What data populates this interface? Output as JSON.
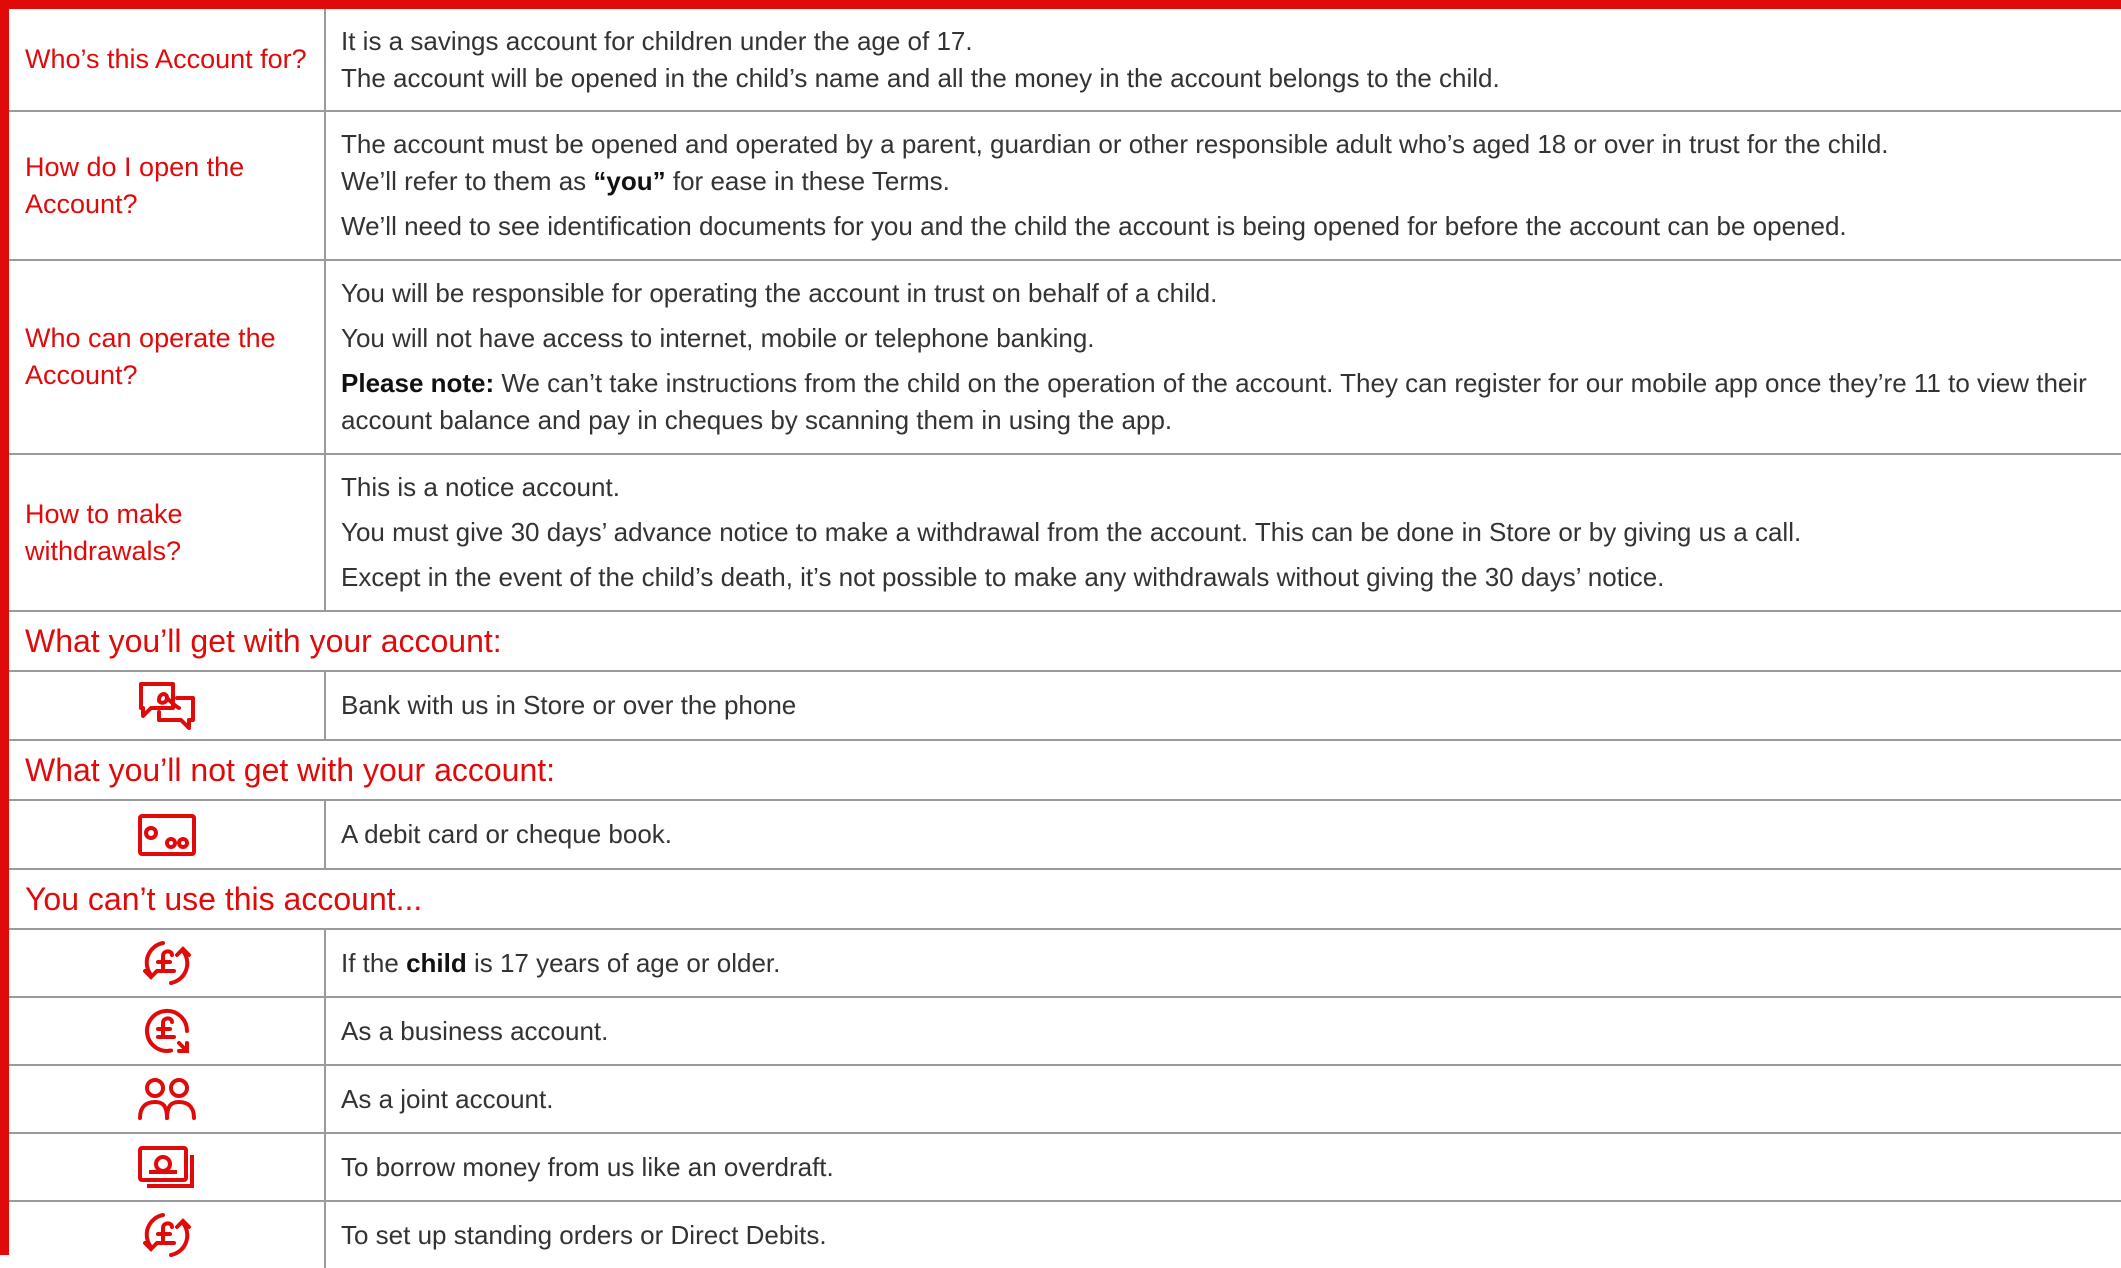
{
  "accent_color": "#e10a0a",
  "questions": [
    {
      "question": "Who’s this Account for?",
      "answers": [
        "It is a savings account for children under the age of 17.",
        "The account will be opened in the child’s name and all the money in the account belongs to the child."
      ]
    },
    {
      "question": "How do I open the Account?",
      "answer_1_a": "The account must be opened and operated by a parent, guardian or other responsible adult who’s aged 18 or over in trust for the child.",
      "answer_1_b": "We’ll refer to them as",
      "answer_1_strong": "“you”",
      "answer_1_c": "for ease in these Terms.",
      "answer_2": "We’ll need to see identification documents for you and the child the account is being opened for before the account can be opened."
    },
    {
      "question": "Who can operate the Account?",
      "answers": [
        "You will be responsible for operating the account in trust on behalf of a child.",
        "You will not have access to internet, mobile or telephone banking."
      ],
      "note_label": "Please note:",
      "note_text": "We can’t take instructions from the child on the operation of the account. They can register for our mobile app once they’re 11 to view their account balance and pay in cheques by scanning them in using the app."
    },
    {
      "question": "How to make withdrawals?",
      "answers": [
        "This is a notice account.",
        "You must give 30 days’ advance notice to make a withdrawal from the account. This can be done in Store or by giving us a call.",
        "Except in the event of the child’s death, it’s not possible to make any withdrawals without giving the 30 days’ notice."
      ]
    }
  ],
  "get": {
    "heading": "What you’ll get with your account:",
    "items": [
      {
        "icon": "chat-bubbles-icon",
        "text": "Bank with us in Store or over the phone"
      }
    ]
  },
  "not_get": {
    "heading": "What you’ll not get with your account:",
    "items": [
      {
        "icon": "card-icon",
        "text": "A debit card or cheque book."
      }
    ]
  },
  "cant_use": {
    "heading": "You can’t use this account...",
    "items": [
      {
        "icon": "pound-cycle-icon",
        "text_a": "If the",
        "text_strong": "child",
        "text_b": "is 17 years of age or older."
      },
      {
        "icon": "pound-business-icon",
        "text": "As a business account."
      },
      {
        "icon": "people-icon",
        "text": "As a joint account."
      },
      {
        "icon": "cash-icon",
        "text": "To borrow money from us like an overdraft."
      },
      {
        "icon": "pound-cycle-icon",
        "text": "To set up standing orders or Direct Debits."
      }
    ]
  }
}
